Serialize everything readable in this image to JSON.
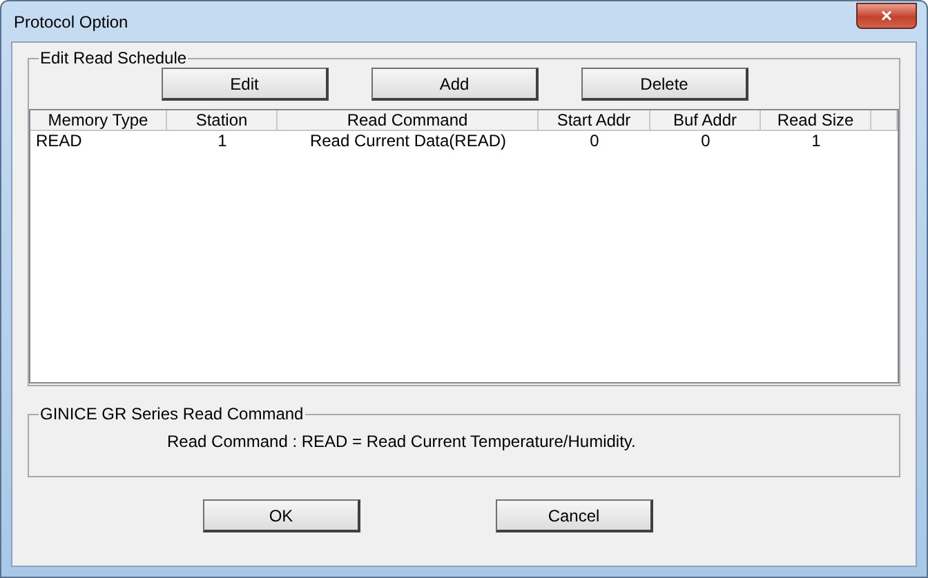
{
  "window": {
    "title": "Protocol Option",
    "close_label": "×"
  },
  "schedule": {
    "title": "Edit Read Schedule",
    "buttons": [
      "Edit",
      "Add",
      "Delete"
    ],
    "columns": [
      "Memory Type",
      "Station",
      "Read Command",
      "Start Addr",
      "Buf Addr",
      "Read Size"
    ],
    "rows": [
      [
        "READ",
        "1",
        "Read Current Data(READ)",
        "0",
        "0",
        "1"
      ]
    ]
  },
  "info": {
    "title": "GINICE GR Series Read Command",
    "text": "Read Command : READ = Read Current Temperature/Humidity."
  },
  "buttons": [
    "OK",
    "Cancel"
  ]
}
